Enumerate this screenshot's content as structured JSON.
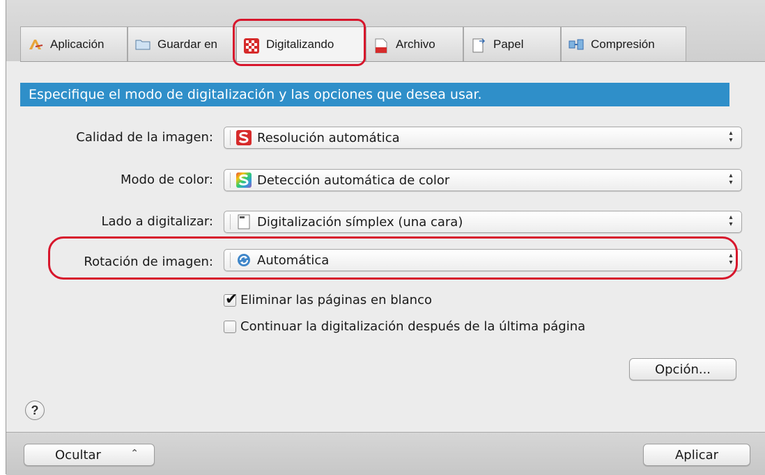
{
  "tabs": [
    {
      "label": "Aplicación",
      "icon": "application-pen-icon",
      "active": false
    },
    {
      "label": "Guardar en",
      "icon": "folder-icon",
      "active": false
    },
    {
      "label": "Digitalizando",
      "icon": "scanning-checker-icon",
      "active": true
    },
    {
      "label": "Archivo",
      "icon": "file-pdf-icon",
      "active": false
    },
    {
      "label": "Papel",
      "icon": "paper-icon",
      "active": false
    },
    {
      "label": "Compresión",
      "icon": "compression-icon",
      "active": false
    }
  ],
  "banner": "Especifique el modo de digitalización y las opciones que desea usar.",
  "fields": {
    "image_quality": {
      "label": "Calidad de la imagen:",
      "value": "Resolución automática"
    },
    "color_mode": {
      "label": "Modo de color:",
      "value": "Detección automática de color"
    },
    "scan_side": {
      "label": "Lado a digitalizar:",
      "value": "Digitalización símplex (una cara)"
    },
    "rotation": {
      "label": "Rotación de imagen:",
      "value": "Automática"
    }
  },
  "checkboxes": {
    "remove_blank": {
      "label": "Eliminar las páginas en blanco",
      "checked": true
    },
    "continue_scan": {
      "label": "Continuar la digitalización después de la última página",
      "checked": false
    }
  },
  "buttons": {
    "option": "Opción...",
    "hide": "Ocultar",
    "apply": "Aplicar",
    "help": "?"
  },
  "colors": {
    "banner": "#2f8fc9",
    "highlight": "#d7162c"
  }
}
